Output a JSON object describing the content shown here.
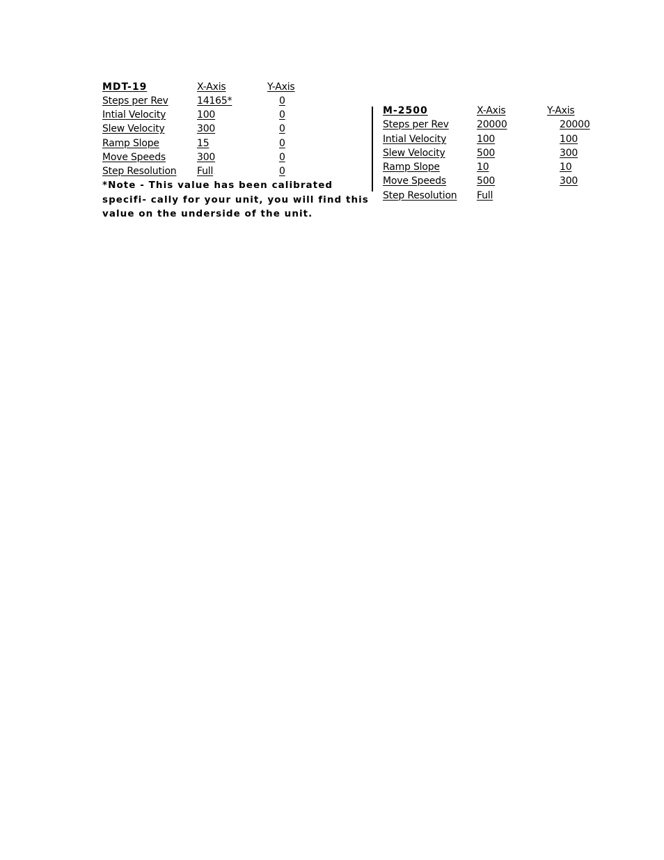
{
  "tables": [
    {
      "title": "MDT-19",
      "headers": [
        "X-Axis",
        "Y-Axis"
      ],
      "rows": [
        {
          "label": "Steps per Rev",
          "x": "14165*",
          "y": "0"
        },
        {
          "label": "Intial Velocity",
          "x": "100",
          "y": "0"
        },
        {
          "label": "Slew Velocity",
          "x": "300",
          "y": "0"
        },
        {
          "label": "Ramp Slope",
          "x": "15",
          "y": "0"
        },
        {
          "label": "Move Speeds",
          "x": "300",
          "y": "0"
        },
        {
          "label": "Step Resolution",
          "x": "Full",
          "y": "0"
        }
      ],
      "note": "*Note - This value has been calibrated specifi- cally for your unit, you will find this value on the underside of the unit."
    },
    {
      "title": "M-2500",
      "headers": [
        "X-Axis",
        "Y-Axis"
      ],
      "rows": [
        {
          "label": "Steps per Rev",
          "x": "20000",
          "y": "20000"
        },
        {
          "label": "Intial Velocity",
          "x": "100",
          "y": "100"
        },
        {
          "label": "Slew Velocity",
          "x": "500",
          "y": "300"
        },
        {
          "label": "Ramp Slope",
          "x": "10",
          "y": "10"
        },
        {
          "label": "Move Speeds",
          "x": "500",
          "y": "300"
        },
        {
          "label": "Step Resolution",
          "x": "Full",
          "y": ""
        }
      ]
    }
  ]
}
